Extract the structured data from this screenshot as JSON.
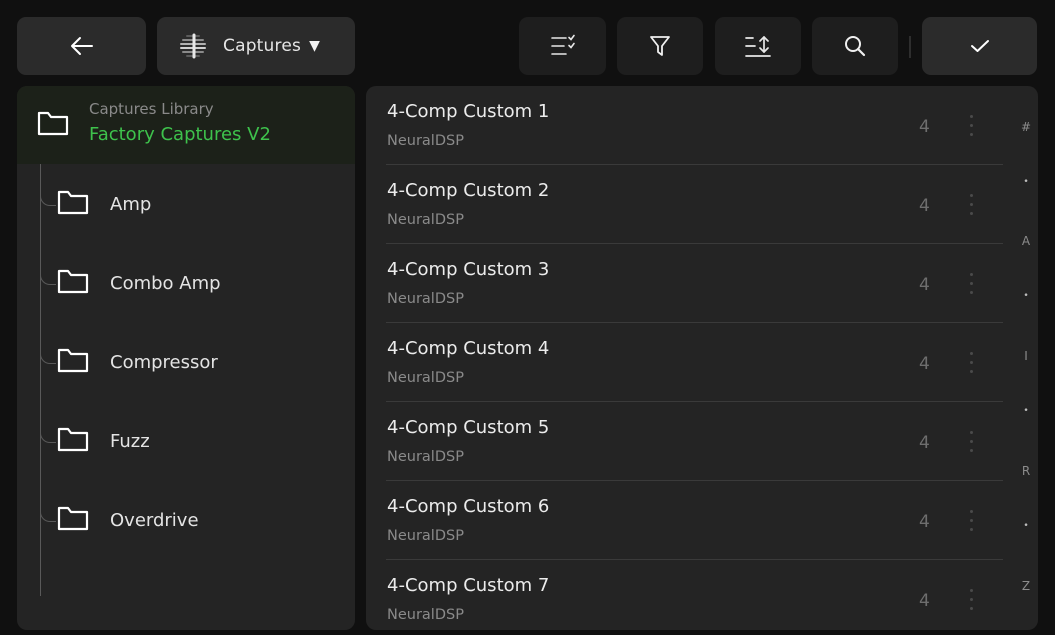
{
  "toolbar": {
    "library_label": "Captures",
    "colors": {
      "button_bg": "#2b2b2b",
      "tool_bg": "#1e1e1e"
    }
  },
  "sidebar": {
    "root": {
      "sublabel": "Captures Library",
      "name": "Factory Captures V2",
      "accent": "#3ec24c"
    },
    "folders": [
      {
        "label": "Amp"
      },
      {
        "label": "Combo Amp"
      },
      {
        "label": "Compressor"
      },
      {
        "label": "Fuzz"
      },
      {
        "label": "Overdrive"
      }
    ]
  },
  "captures": [
    {
      "name": "4-Comp Custom 1",
      "maker": "NeuralDSP",
      "count": "4"
    },
    {
      "name": "4-Comp Custom 2",
      "maker": "NeuralDSP",
      "count": "4"
    },
    {
      "name": "4-Comp Custom 3",
      "maker": "NeuralDSP",
      "count": "4"
    },
    {
      "name": "4-Comp Custom 4",
      "maker": "NeuralDSP",
      "count": "4"
    },
    {
      "name": "4-Comp Custom 5",
      "maker": "NeuralDSP",
      "count": "4"
    },
    {
      "name": "4-Comp Custom 6",
      "maker": "NeuralDSP",
      "count": "4"
    },
    {
      "name": "4-Comp Custom 7",
      "maker": "NeuralDSP",
      "count": "4"
    }
  ],
  "alpha_index": [
    "#",
    "•",
    "A",
    "•",
    "I",
    "•",
    "R",
    "•",
    "Z"
  ]
}
